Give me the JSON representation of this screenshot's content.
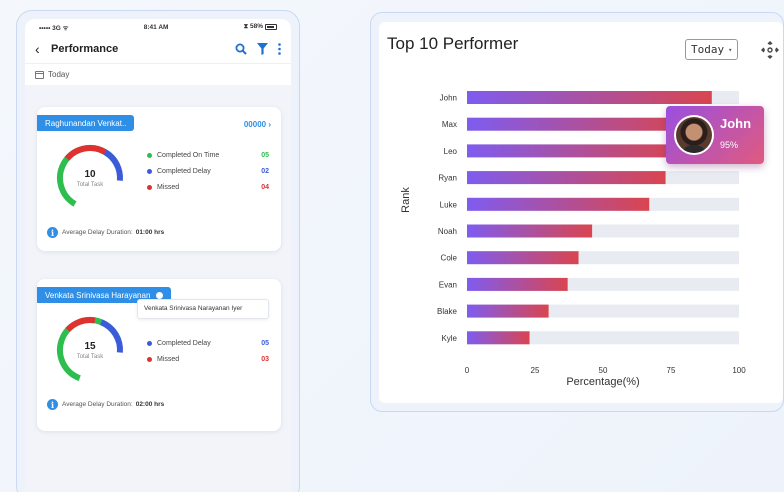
{
  "phone": {
    "status": {
      "carrier": "••••• 3G ᯤ",
      "time": "8:41 AM",
      "battery": "⧗ 58%"
    },
    "nav": {
      "back": "‹",
      "title": "Performance"
    },
    "filter": {
      "label": "Today"
    },
    "cards": [
      {
        "tag": "Raghunandan Venkat..",
        "code": "00000",
        "total": "10",
        "total_label": "Total Task",
        "legend": [
          {
            "label": "Completed On Time",
            "value": "05",
            "color": "#2ebd4f"
          },
          {
            "label": "Completed Delay",
            "value": "02",
            "color": "#3b5bdb"
          },
          {
            "label": "Missed",
            "value": "04",
            "color": "#e03131"
          }
        ],
        "footer_label": "Average Delay Duration:",
        "footer_value": "01:00 hrs"
      },
      {
        "tag": "Venkata Srinivasa Harayanan",
        "tooltip": "Venkata Srinivasa Narayanan Iyer",
        "total": "15",
        "total_label": "Total Task",
        "legend": [
          {
            "label": "Completed Delay",
            "value": "05",
            "color": "#3b5bdb"
          },
          {
            "label": "Missed",
            "value": "03",
            "color": "#e03131"
          }
        ],
        "footer_label": "Average Delay Duration:",
        "footer_value": "02:00 hrs"
      }
    ]
  },
  "panel": {
    "title": "Top 10 Performer",
    "period": "Today",
    "hover": {
      "name": "John",
      "percent": "95%"
    }
  },
  "chart_data": {
    "type": "bar",
    "orientation": "horizontal",
    "categories": [
      "John",
      "Max",
      "Leo",
      "Ryan",
      "Luke",
      "Noah",
      "Cole",
      "Evan",
      "Blake",
      "Kyle"
    ],
    "values": [
      90,
      82,
      78,
      73,
      67,
      46,
      41,
      37,
      30,
      23
    ],
    "track_max": 100,
    "xlabel": "Percentage(%)",
    "ylabel": "Rank",
    "xlim": [
      0,
      100
    ],
    "xticks": [
      "0",
      "25",
      "50",
      "75",
      "100"
    ],
    "colors": {
      "bar_start": "#7e5cf0",
      "bar_end": "#d9454f",
      "track": "#e9ebf2"
    }
  }
}
